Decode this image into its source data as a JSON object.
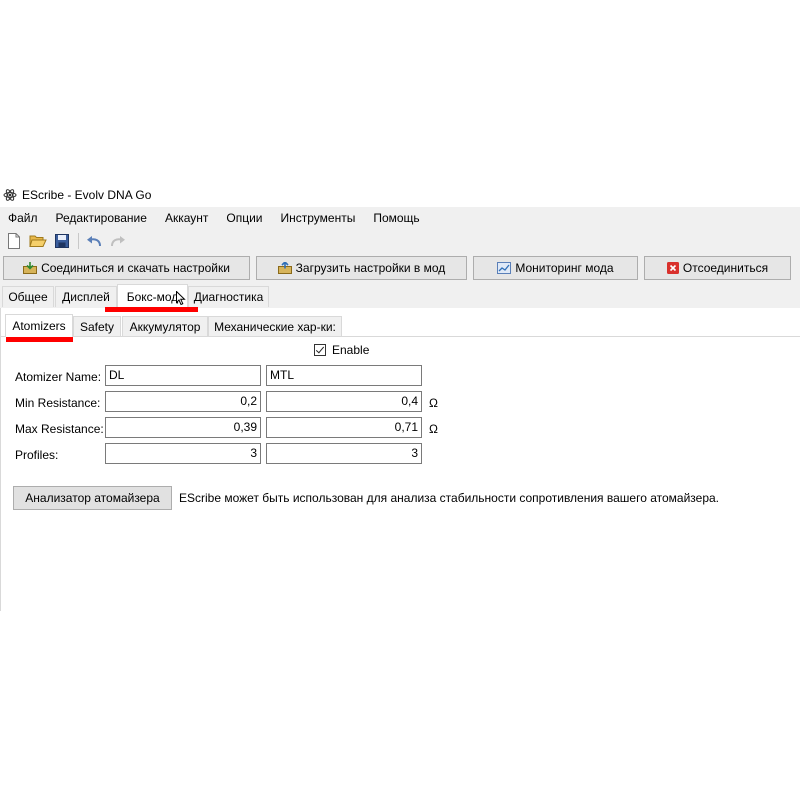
{
  "window": {
    "title": "EScribe - Evolv DNA Go"
  },
  "menu": [
    "Файл",
    "Редактирование",
    "Аккаунт",
    "Опции",
    "Инструменты",
    "Помощь"
  ],
  "toolbar": {
    "icons": [
      "new-file-icon",
      "open-folder-icon",
      "save-disk-icon",
      "undo-icon",
      "redo-icon"
    ]
  },
  "actions": {
    "connect": "Соединиться и скачать настройки",
    "upload": "Загрузить настройки в мод",
    "monitor": "Мониторинг мода",
    "disconnect": "Отсоединиться"
  },
  "main_tabs": [
    "Общее",
    "Дисплей",
    "Бокс-мод",
    "Диагностика"
  ],
  "sub_tabs": [
    "Atomizers",
    "Safety",
    "Аккумулятор",
    "Механические хар-ки:"
  ],
  "enable": {
    "label": "Enable",
    "checked": true
  },
  "form": {
    "labels": {
      "name": "Atomizer Name:",
      "min": "Min Resistance:",
      "max": "Max Resistance:",
      "profiles": "Profiles:"
    },
    "name": [
      "DL",
      "MTL"
    ],
    "min": [
      "0,2",
      "0,4"
    ],
    "max": [
      "0,39",
      "0,71"
    ],
    "profiles": [
      "3",
      "3"
    ],
    "unit": "Ω"
  },
  "analyzer": {
    "button": "Анализатор атомайзера",
    "description": "EScribe может быть использован для анализа стабильности сопротивления вашего атомайзера."
  },
  "colors": {
    "highlight": "#ff0000"
  }
}
